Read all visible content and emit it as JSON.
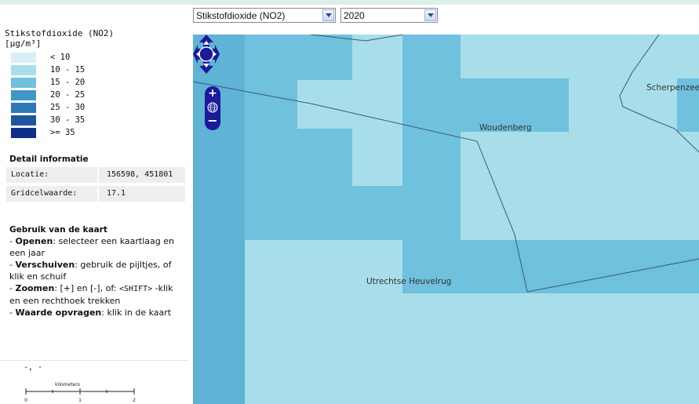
{
  "toolbar": {
    "layer_select": "Stikstofdioxide (NO2)",
    "year_select": "2020"
  },
  "legend": {
    "title_line1": "Stikstofdioxide (NO2)",
    "title_line2": "[µg/m³]",
    "classes": [
      {
        "label": "< 10",
        "color": "#d8f0f5"
      },
      {
        "label": "10 - 15",
        "color": "#a7deea"
      },
      {
        "label": "15 - 20",
        "color": "#6fc1dd"
      },
      {
        "label": "20 - 25",
        "color": "#3f96c8"
      },
      {
        "label": "25 - 30",
        "color": "#2f78b8"
      },
      {
        "label": "30 - 35",
        "color": "#1f559e"
      },
      {
        "label": ">= 35",
        "color": "#0e2f8a"
      }
    ]
  },
  "detail": {
    "title": "Detail informatie",
    "location_key": "Locatie:",
    "location_value": "156598, 451801",
    "gridcell_key": "Gridcelwaarde:",
    "gridcell_value": "17.1"
  },
  "usage": {
    "title": "Gebruik van de kaart",
    "open_b": "Openen",
    "open_t": ": selecteer een kaartlaag en een jaar",
    "shift_b": "Verschuiven",
    "shift_t": ": gebruik de pijltjes, of klik en schuif",
    "zoom_b": "Zoomen",
    "zoom_t1": ": [+] en [-], of: ",
    "zoom_mono": "<SHIFT>",
    "zoom_t2": " -klik en een rechthoek trekken",
    "query_b": "Waarde opvragen",
    "query_t": ": klik in de kaart"
  },
  "coords_readout": "-, -",
  "scalebar": {
    "unit": "kilometers",
    "ticks": [
      "0",
      "1",
      "2"
    ]
  },
  "map": {
    "places": {
      "woudenberg": "Woudenberg",
      "scherpenzeel": "Scherpenzee",
      "heuvelrug": "Utrechtse Heuvelrug"
    }
  }
}
